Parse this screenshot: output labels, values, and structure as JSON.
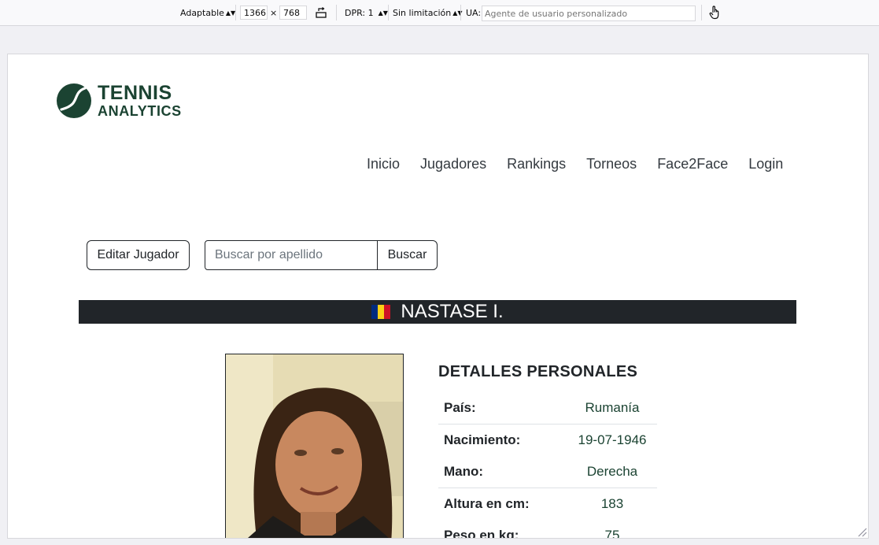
{
  "toolbar": {
    "device": "Adaptable",
    "width": "1366",
    "times": "×",
    "height": "768",
    "dpr": "DPR: 1",
    "throttle": "Sin limitación",
    "ua_label": "UA:",
    "ua_placeholder": "Agente de usuario personalizado"
  },
  "logo": {
    "line1": "TENNIS",
    "line2": "ANALYTICS"
  },
  "nav": [
    "Inicio",
    "Jugadores",
    "Rankings",
    "Torneos",
    "Face2Face",
    "Login"
  ],
  "actions": {
    "edit_label": "Editar Jugador",
    "search_placeholder": "Buscar por apellido",
    "search_label": "Buscar"
  },
  "player": {
    "name": "NASTASE I.",
    "flag_colors": [
      "#002b7f",
      "#fcd116",
      "#ce1126"
    ]
  },
  "details": {
    "title": "DETALLES PERSONALES",
    "rows": [
      {
        "label": "País:",
        "value": "Rumanía"
      },
      {
        "label": "Nacimiento:",
        "value": "19-07-1946"
      },
      {
        "label": "Mano:",
        "value": "Derecha"
      },
      {
        "label": "Altura en cm:",
        "value": "183"
      },
      {
        "label": "Peso en kg:",
        "value": "75"
      }
    ]
  },
  "colors": {
    "brand": "#1b4332",
    "banner": "#212529"
  }
}
